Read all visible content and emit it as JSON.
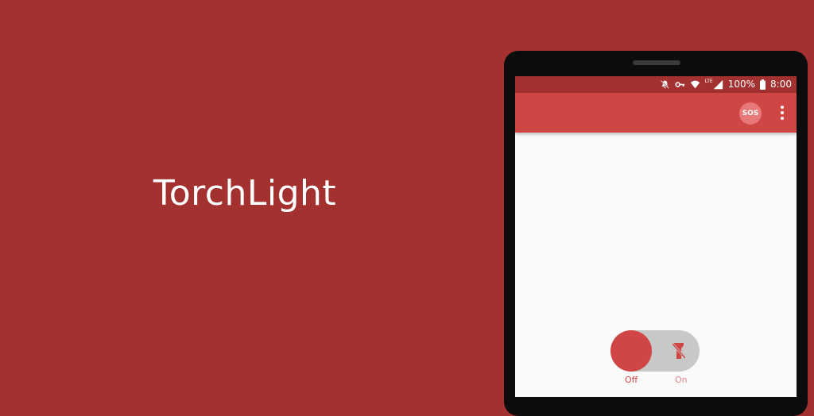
{
  "banner": {
    "title": "TorchLight"
  },
  "statusbar": {
    "battery": "100%",
    "time": "8:00",
    "network": "LTE",
    "icons": [
      "mute-icon",
      "vpn-key-icon",
      "wifi-icon",
      "signal-icon",
      "battery-icon"
    ]
  },
  "appbar": {
    "sos_label": "SOS",
    "more_icon": "more-vert-icon"
  },
  "toggle": {
    "off_label": "Off",
    "on_label": "On",
    "state": "off",
    "icon": "flash-off-icon"
  },
  "colors": {
    "background": "#a23130",
    "primary": "#cf4645",
    "sos": "#e8787a",
    "track": "#c8c8c8"
  }
}
